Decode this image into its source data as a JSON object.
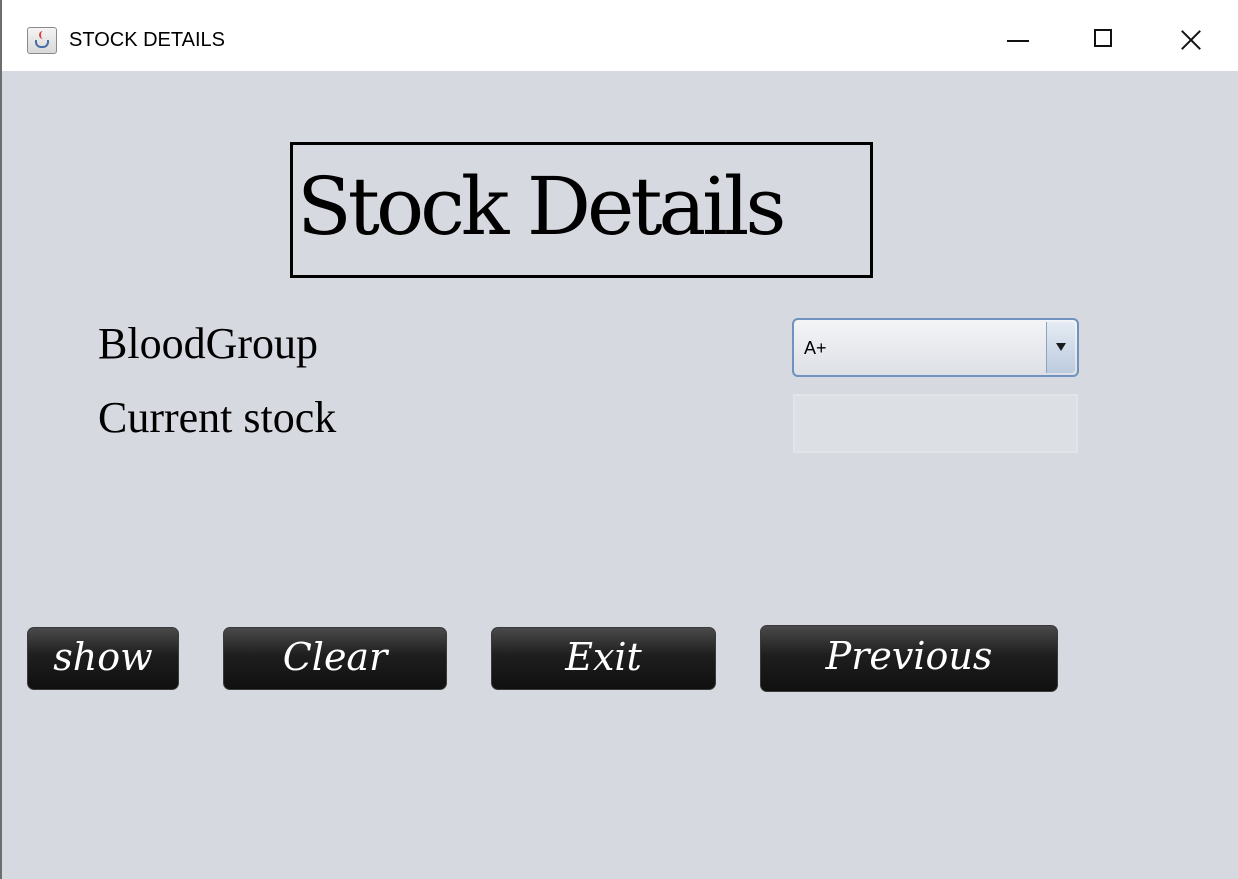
{
  "window": {
    "title": "STOCK DETAILS",
    "app_icon": "java-cup-icon"
  },
  "title_bar_controls": [
    "minimize-icon",
    "maximize-icon",
    "close-icon"
  ],
  "heading": "Stock Details",
  "form": {
    "blood_group_label": "BloodGroup",
    "blood_group_value": "A+",
    "current_stock_label": "Current stock",
    "current_stock_value": ""
  },
  "buttons": {
    "show": "show",
    "clear": "Clear",
    "exit": "Exit",
    "previous": "Previous"
  },
  "colors": {
    "background": "#d6d9e0",
    "button": "#1e1e1e",
    "combo_border": "#6f93bd"
  }
}
